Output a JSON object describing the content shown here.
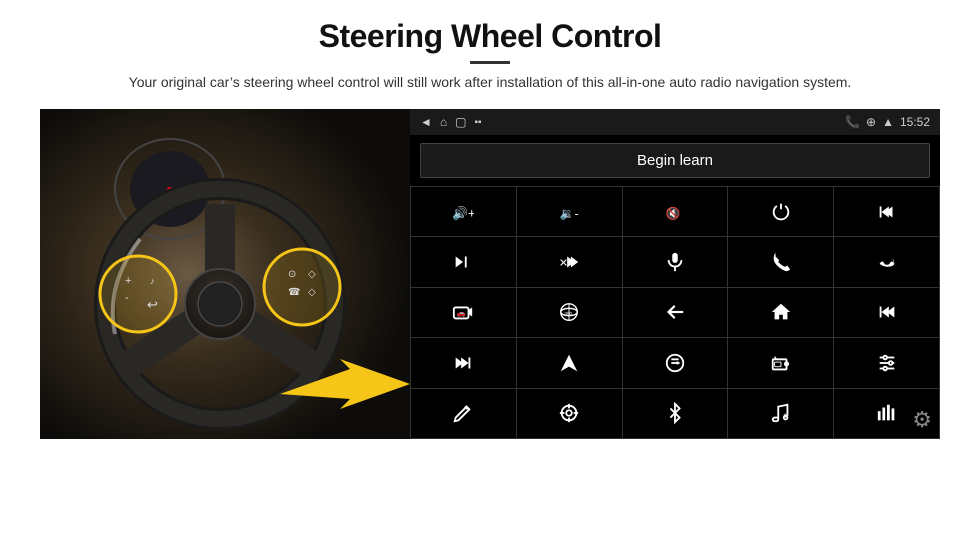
{
  "page": {
    "title": "Steering Wheel Control",
    "subtitle": "Your original car’s steering wheel control will still work after installation of this all-in-one auto radio navigation system.",
    "divider": true
  },
  "status_bar": {
    "back_icon": "◄",
    "home_icon": "⌂",
    "recent_icon": "□",
    "phone_icon": "☎",
    "location_icon": "⌖",
    "wifi_icon": "▲",
    "signal_icon": "■■",
    "time": "15:52"
  },
  "begin_learn": {
    "label": "Begin learn"
  },
  "grid_icons": [
    {
      "id": "vol-up",
      "symbol": "vol+"
    },
    {
      "id": "vol-down",
      "symbol": "vol-"
    },
    {
      "id": "mute",
      "symbol": "mute"
    },
    {
      "id": "power",
      "symbol": "pwr"
    },
    {
      "id": "prev-track",
      "symbol": "prev"
    },
    {
      "id": "skip-forward",
      "symbol": "skip+"
    },
    {
      "id": "fast-fwd",
      "symbol": "ff"
    },
    {
      "id": "mic",
      "symbol": "mic"
    },
    {
      "id": "phone",
      "symbol": "phone"
    },
    {
      "id": "hang-up",
      "symbol": "hangup"
    },
    {
      "id": "cam",
      "symbol": "cam"
    },
    {
      "id": "360",
      "symbol": "360"
    },
    {
      "id": "back",
      "symbol": "back"
    },
    {
      "id": "home",
      "symbol": "home"
    },
    {
      "id": "skip-back",
      "symbol": "prev2"
    },
    {
      "id": "skip-next2",
      "symbol": "next2"
    },
    {
      "id": "nav",
      "symbol": "nav"
    },
    {
      "id": "eq",
      "symbol": "eq"
    },
    {
      "id": "radio",
      "symbol": "radio"
    },
    {
      "id": "settings2",
      "symbol": "adj"
    },
    {
      "id": "pen",
      "symbol": "pen"
    },
    {
      "id": "target",
      "symbol": "tgt"
    },
    {
      "id": "bluetooth",
      "symbol": "bt"
    },
    {
      "id": "music",
      "symbol": "music"
    },
    {
      "id": "spectrum",
      "symbol": "spec"
    }
  ],
  "settings": {
    "icon": "⚙"
  }
}
